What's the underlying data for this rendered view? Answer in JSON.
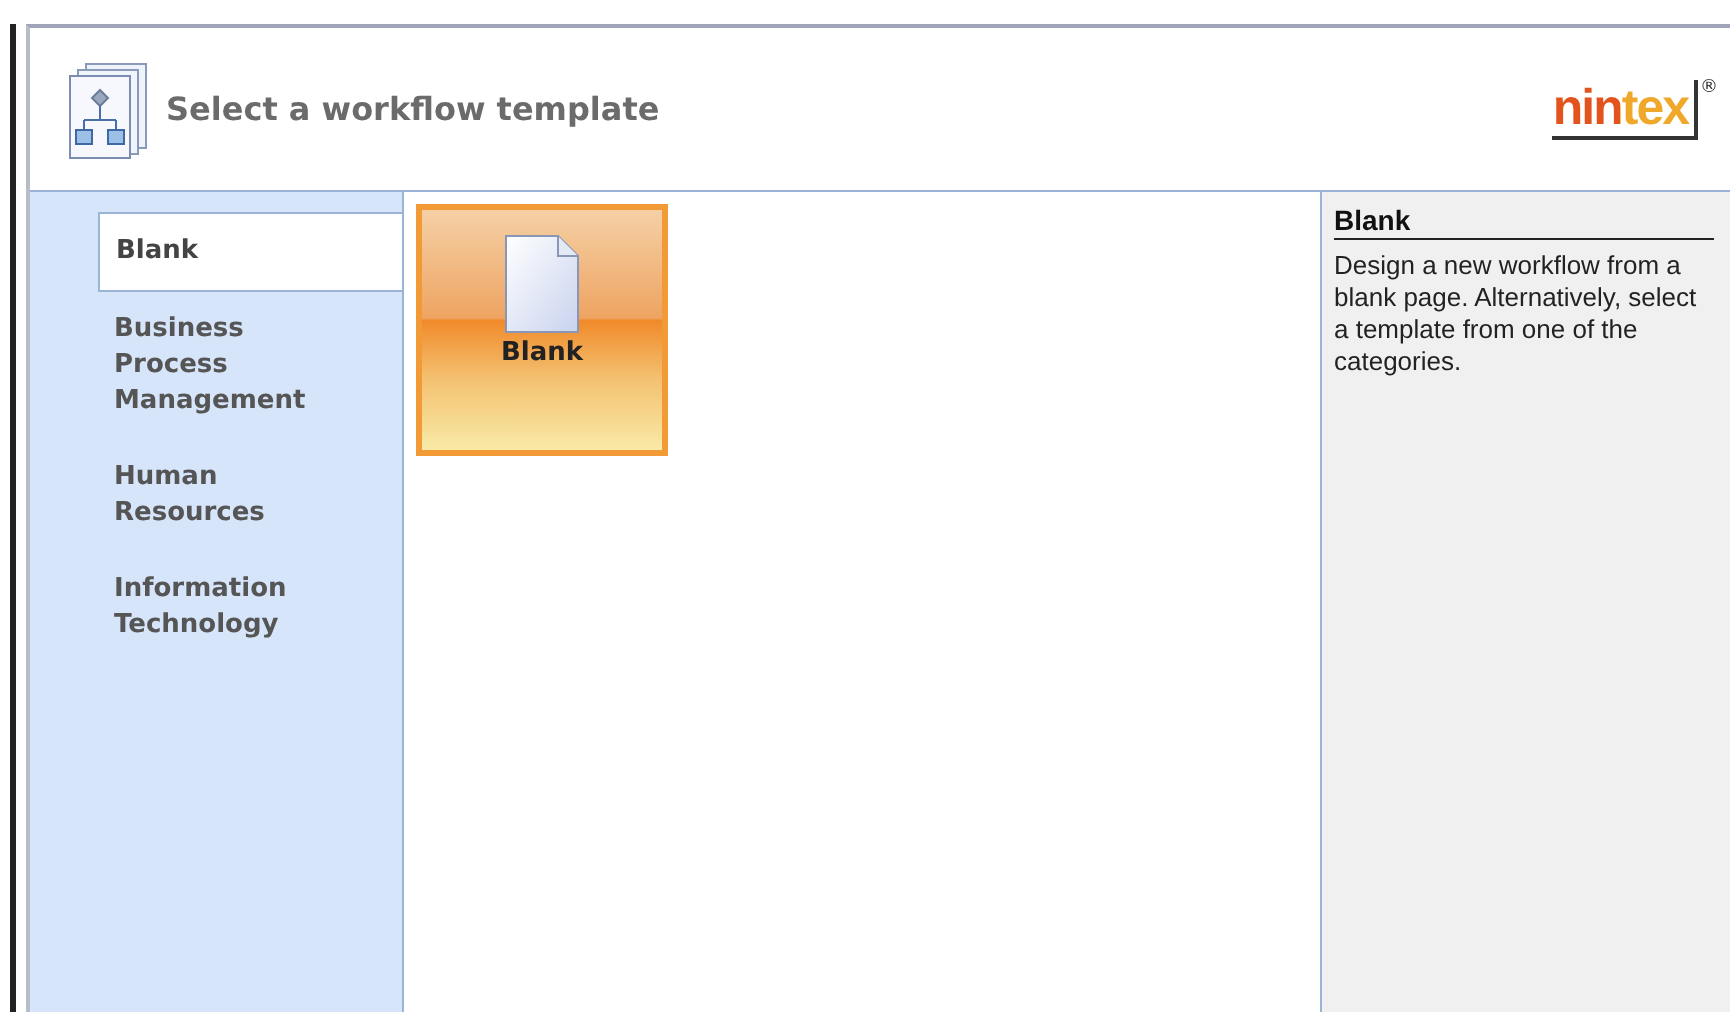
{
  "header": {
    "title": "Select a workflow template",
    "logo": "nintex",
    "logo_mark": "®"
  },
  "categories": [
    {
      "label": "Blank",
      "selected": true
    },
    {
      "label": "Business Process Management",
      "selected": false
    },
    {
      "label": "Human Resources",
      "selected": false
    },
    {
      "label": "Information Technology",
      "selected": false
    }
  ],
  "templates": [
    {
      "label": "Blank",
      "selected": true
    }
  ],
  "details": {
    "title": "Blank",
    "description": "Design a new workflow from a blank page. Alternatively, select a template from one of the categories."
  }
}
